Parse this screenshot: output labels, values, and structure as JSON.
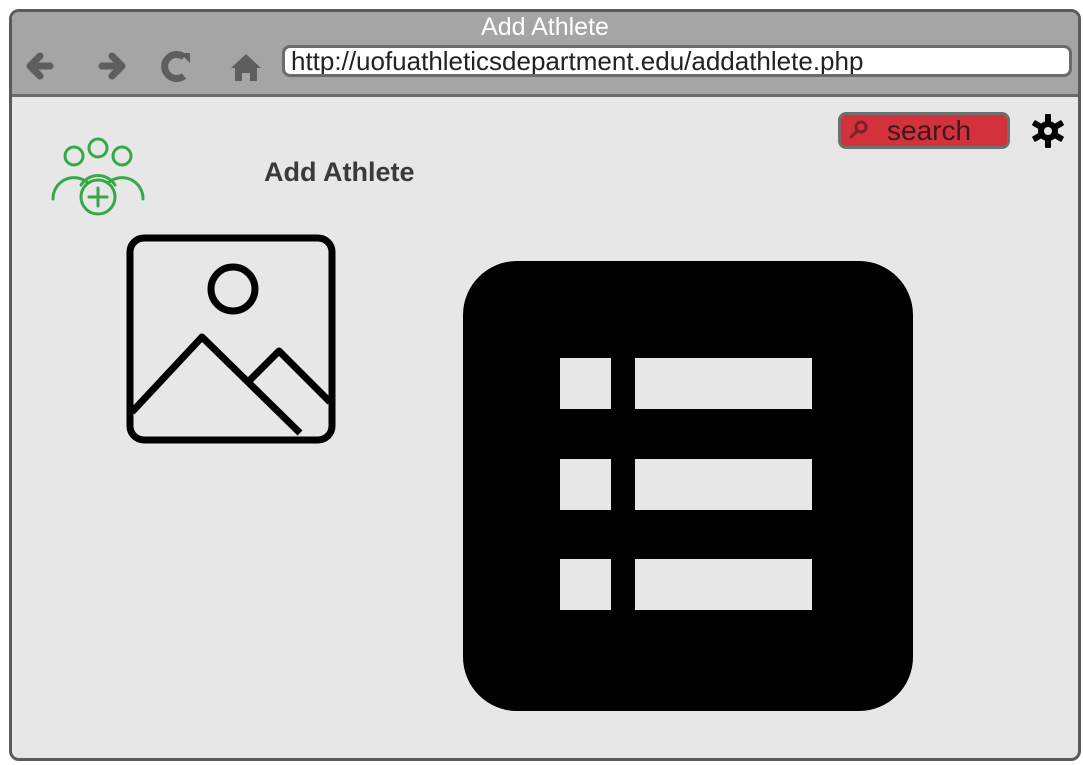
{
  "window": {
    "title": "Add Athlete"
  },
  "toolbar": {
    "back_icon": "arrow-left-icon",
    "forward_icon": "arrow-right-icon",
    "reload_icon": "reload-icon",
    "home_icon": "home-icon",
    "url": "http://uofuathleticsdepartment.edu/addathlete.php"
  },
  "header": {
    "search_placeholder": "search",
    "search_icon": "search-icon",
    "settings_icon": "gear-icon"
  },
  "main": {
    "add_group_icon": "add-user-group-icon",
    "title": "Add Athlete",
    "image_icon": "image-placeholder-icon",
    "list_icon": "list-icon"
  },
  "colors": {
    "window_bg": "#e7e7e7",
    "titlebar_bg": "#a5a5a5",
    "accent_green": "#35a84a",
    "search_red": "#d3323c"
  }
}
